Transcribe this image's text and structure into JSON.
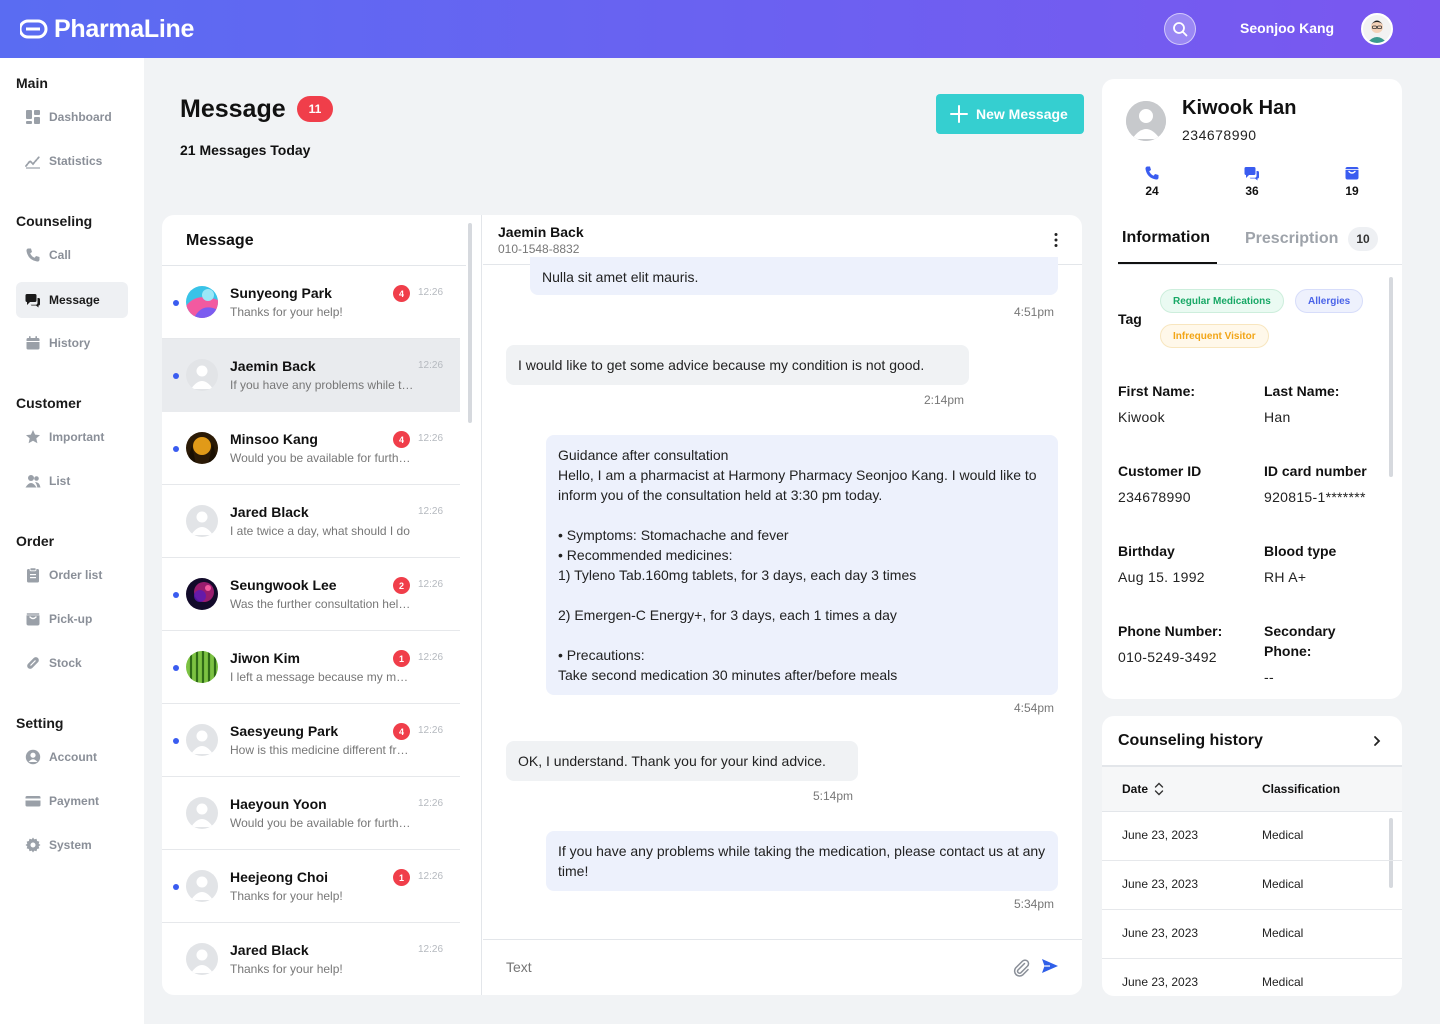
{
  "app": {
    "name": "PharmaLine"
  },
  "user": {
    "name": "Seonjoo Kang"
  },
  "sidebar": {
    "sections": [
      {
        "title": "Main",
        "items": [
          {
            "label": "Dashboard",
            "icon": "dashboard-icon"
          },
          {
            "label": "Statistics",
            "icon": "statistics-icon"
          }
        ]
      },
      {
        "title": "Counseling",
        "items": [
          {
            "label": "Call",
            "icon": "phone-icon"
          },
          {
            "label": "Message",
            "icon": "chat-icon",
            "active": true
          },
          {
            "label": "History",
            "icon": "calendar-icon"
          }
        ]
      },
      {
        "title": "Customer",
        "items": [
          {
            "label": "Important",
            "icon": "star-icon"
          },
          {
            "label": "List",
            "icon": "users-icon"
          }
        ]
      },
      {
        "title": "Order",
        "items": [
          {
            "label": "Order list",
            "icon": "clipboard-icon"
          },
          {
            "label": "Pick-up",
            "icon": "box-icon"
          },
          {
            "label": "Stock",
            "icon": "pill-icon"
          }
        ]
      },
      {
        "title": "Setting",
        "items": [
          {
            "label": "Account",
            "icon": "user-circle-icon"
          },
          {
            "label": "Payment",
            "icon": "card-icon"
          },
          {
            "label": "System",
            "icon": "gear-icon"
          }
        ]
      }
    ]
  },
  "header": {
    "title": "Message",
    "badge": "11",
    "subtitle": "21 Messages Today",
    "new_button": "New Message"
  },
  "message_list": {
    "title": "Message",
    "items": [
      {
        "name": "Sunyeong Park",
        "preview": "Thanks for your help!",
        "time": "12:26",
        "badge": "4",
        "unread": true,
        "avatar": "colorful"
      },
      {
        "name": "Jaemin Back",
        "preview": "If you have any problems while taking the medication",
        "time": "12:26",
        "badge": "",
        "unread": true,
        "avatar": "default",
        "active": true
      },
      {
        "name": "Minsoo Kang",
        "preview": "Would you be available for further consultation",
        "time": "12:26",
        "badge": "4",
        "unread": true,
        "avatar": "forest"
      },
      {
        "name": "Jared Black",
        "preview": "I ate twice a day, what should I do",
        "time": "12:26",
        "badge": "",
        "unread": false,
        "avatar": "default"
      },
      {
        "name": "Seungwook Lee",
        "preview": "Was the further consultation helpful",
        "time": "12:26",
        "badge": "2",
        "unread": true,
        "avatar": "galaxy"
      },
      {
        "name": "Jiwon Kim",
        "preview": "I left a message because my medicine",
        "time": "12:26",
        "badge": "1",
        "unread": true,
        "avatar": "melon"
      },
      {
        "name": "Saesyeung Park",
        "preview": "How is this medicine different from the other",
        "time": "12:26",
        "badge": "4",
        "unread": true,
        "avatar": "default"
      },
      {
        "name": "Haeyoun Yoon",
        "preview": "Would you be available for further consultation",
        "time": "12:26",
        "badge": "",
        "unread": false,
        "avatar": "default"
      },
      {
        "name": "Heejeong Choi",
        "preview": "Thanks for your help!",
        "time": "12:26",
        "badge": "1",
        "unread": true,
        "avatar": "default"
      },
      {
        "name": "Jared Black",
        "preview": "Thanks for your help!",
        "time": "12:26",
        "badge": "",
        "unread": false,
        "avatar": "default"
      }
    ]
  },
  "chat": {
    "name": "Jaemin Back",
    "phone": "010-1548-8832",
    "messages": [
      {
        "text": "Nulla sit amet elit mauris.",
        "time": "4:51pm"
      },
      {
        "text": "I would like to get some advice because my condition is not good.",
        "time": "2:14pm"
      },
      {
        "text": "Guidance after consultation\nHello, I am a pharmacist at Harmony Pharmacy Seonjoo Kang. I would like to inform you of the consultation held at 3:30 pm today.\n\n• Symptoms: Stomachache and fever\n• Recommended medicines:\n1) Tyleno Tab.160mg tablets, for 3 days, each day 3 times\n\n2) Emergen-C Energy+, for 3 days, each 1 times a day\n\n• Precautions:\nTake second medication 30 minutes after/before meals",
        "time": "4:54pm"
      },
      {
        "text": "OK, I understand. Thank you for your kind advice.",
        "time": "5:14pm"
      },
      {
        "text": "If you have any problems while taking the medication, please contact us at any time!",
        "time": "5:34pm"
      }
    ],
    "input_placeholder": "Text"
  },
  "profile": {
    "name": "Kiwook Han",
    "id": "234678990",
    "stats": {
      "calls": "24",
      "messages": "36",
      "pickups": "19"
    },
    "tabs": {
      "info": "Information",
      "prescription": "Prescription",
      "prescription_count": "10"
    },
    "tag_label": "Tag",
    "tags": {
      "regular": "Regular Medications",
      "allergies": "Allergies",
      "infrequent": "Infrequent Visitor"
    },
    "fields": {
      "first_name_label": "First Name:",
      "first_name": "Kiwook",
      "last_name_label": "Last Name:",
      "last_name": "Han",
      "customer_id_label": "Customer ID",
      "customer_id": "234678990",
      "id_card_label": "ID card number",
      "id_card": "920815-1*******",
      "birthday_label": "Birthday",
      "birthday": "Aug 15. 1992",
      "blood_label": "Blood type",
      "blood": "RH A+",
      "phone_label": "Phone Number:",
      "phone": "010-5249-3492",
      "secondary_label": "Secondary Phone:",
      "secondary": "--"
    }
  },
  "history": {
    "title": "Counseling history",
    "columns": {
      "date": "Date",
      "classification": "Classification"
    },
    "rows": [
      {
        "date": "June 23, 2023",
        "classification": "Medical"
      },
      {
        "date": "June 23, 2023",
        "classification": "Medical"
      },
      {
        "date": "June 23, 2023",
        "classification": "Medical"
      },
      {
        "date": "June 23, 2023",
        "classification": "Medical"
      }
    ]
  },
  "colors": {
    "brand_start": "#5a6cf2",
    "brand_end": "#7a57f0",
    "accent_teal": "#35cfd0",
    "badge_red": "#f03e4a",
    "unread_dot": "#3a5cf0"
  }
}
